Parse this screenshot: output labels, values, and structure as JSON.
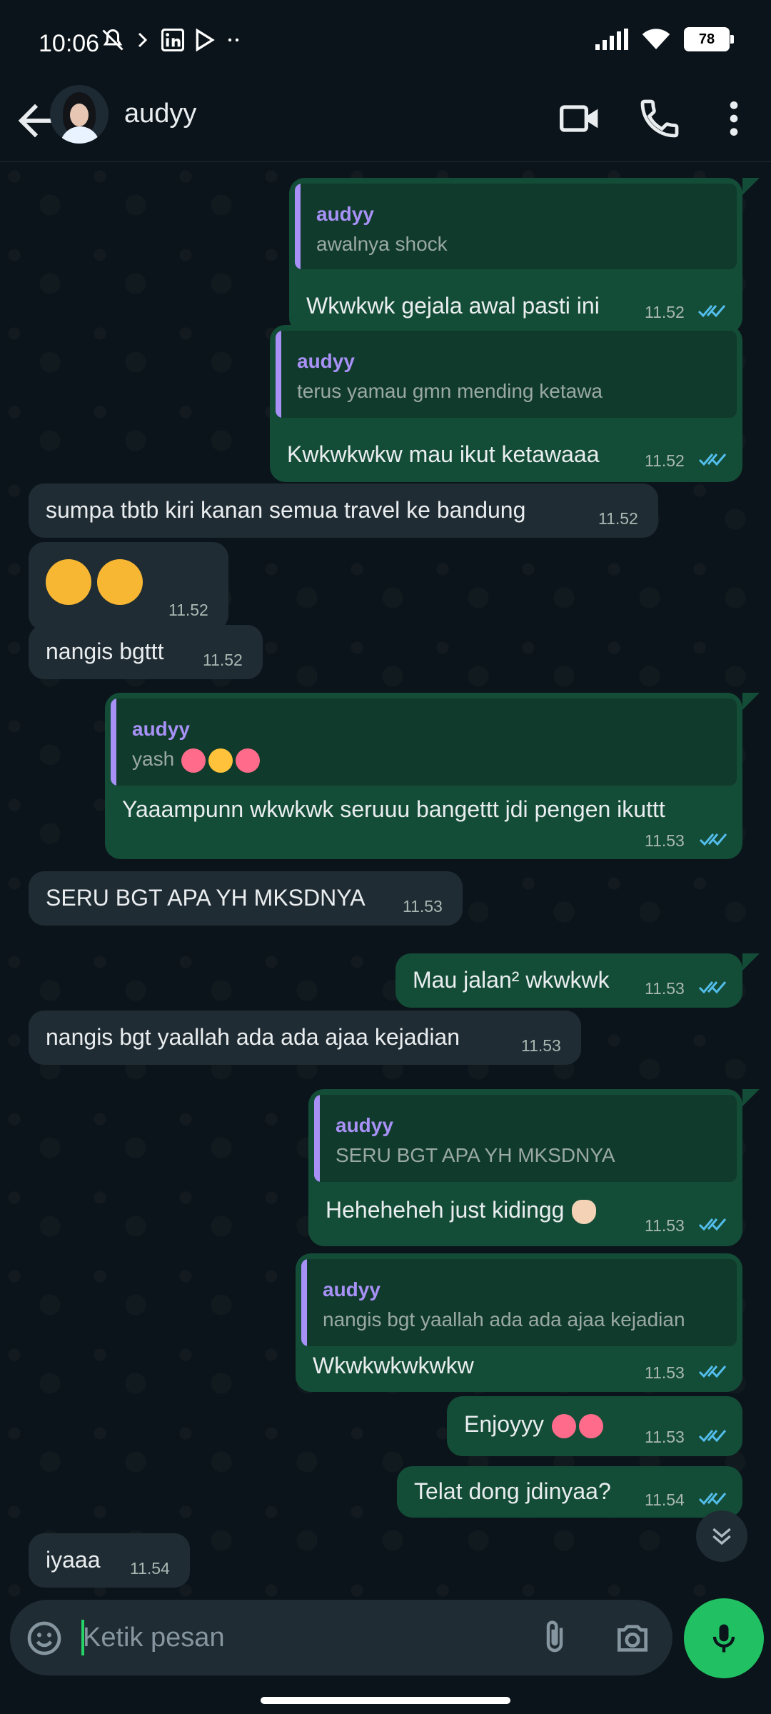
{
  "status_bar": {
    "time": "10:06",
    "battery": "78"
  },
  "header": {
    "contact_name": "audyy"
  },
  "messages": [
    {
      "dir": "out",
      "quote_name": "audyy",
      "quote_text": "awalnya shock",
      "text": "Wkwkwk gejala awal pasti ini",
      "time": "11.52"
    },
    {
      "dir": "out",
      "quote_name": "audyy",
      "quote_text": "terus yamau gmn mending ketawa",
      "text": "Kwkwkwkw mau ikut ketawaaa",
      "time": "11.52"
    },
    {
      "dir": "in",
      "text": "sumpa tbtb kiri kanan semua travel ke bandung",
      "time": "11.52"
    },
    {
      "dir": "in",
      "text": "",
      "time": "11.52"
    },
    {
      "dir": "in",
      "text": "nangis bgttt",
      "time": "11.52"
    },
    {
      "dir": "out",
      "quote_name": "audyy",
      "quote_text": "yash",
      "text": "Yaaampunn wkwkwk seruuu bangettt jdi pengen ikuttt",
      "time": "11.53"
    },
    {
      "dir": "in",
      "text": "SERU BGT APA YH MKSDNYA",
      "time": "11.53"
    },
    {
      "dir": "out",
      "text": "Mau jalan² wkwkwk",
      "time": "11.53"
    },
    {
      "dir": "in",
      "text": "nangis bgt yaallah ada ada ajaa kejadian",
      "time": "11.53"
    },
    {
      "dir": "out",
      "quote_name": "audyy",
      "quote_text": "SERU BGT APA YH MKSDNYA",
      "text": "Heheheheh just kidingg",
      "time": "11.53"
    },
    {
      "dir": "out",
      "quote_name": "audyy",
      "quote_text": "nangis bgt yaallah ada ada ajaa kejadian",
      "text": "Wkwkwkwkwkw",
      "time": "11.53"
    },
    {
      "dir": "out",
      "text": "Enjoyyy",
      "time": "11.53"
    },
    {
      "dir": "out",
      "text": "Telat dong jdinyaa?",
      "time": "11.54"
    },
    {
      "dir": "in",
      "text": "iyaaa",
      "time": "11.54"
    }
  ],
  "composer": {
    "placeholder": "Ketik pesan"
  },
  "colors": {
    "outgoing_bubble": "#144d37",
    "incoming_bubble": "#202c33",
    "read_ticks": "#53bdeb",
    "quote_accent": "#a791f6",
    "mic_button": "#21c063"
  },
  "icons": [
    "back-arrow-icon",
    "video-call-icon",
    "phone-icon",
    "more-vert-icon",
    "sticker-icon",
    "attach-icon",
    "camera-icon",
    "mic-icon",
    "chevron-down-icon",
    "double-check-icon"
  ]
}
